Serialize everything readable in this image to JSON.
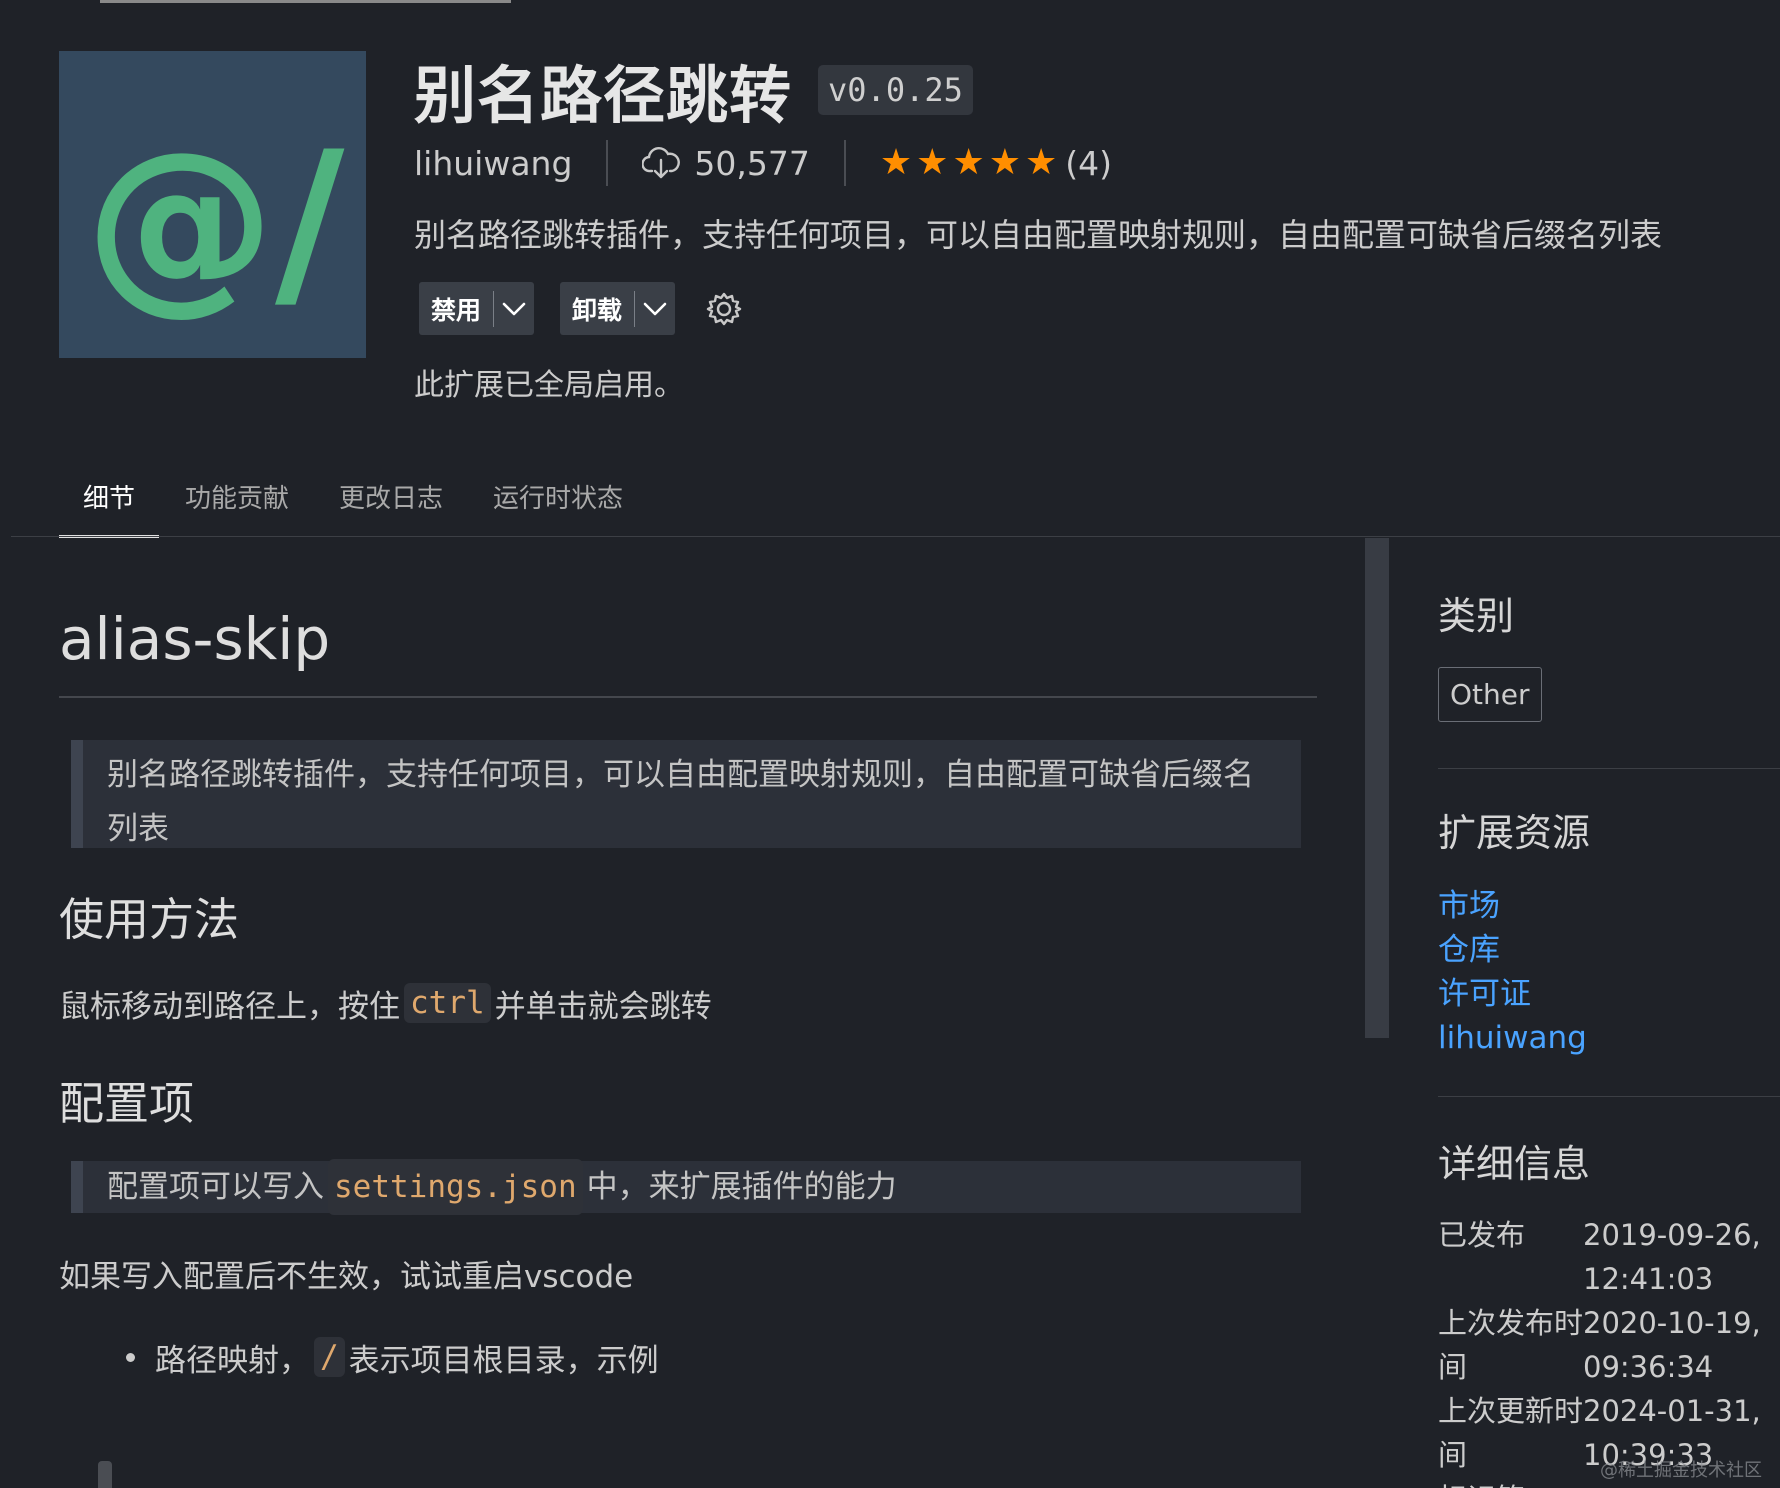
{
  "header": {
    "title": "别名路径跳转",
    "version": "v0.0.25",
    "publisher": "lihuiwang",
    "install_count": "50,577",
    "rating_count": "(4)",
    "rating_stars": 5,
    "description": "别名路径跳转插件，支持任何项目，可以自由配置映射规则，自由配置可缺省后缀名列表",
    "icon_text": "@/",
    "icon_colors": {
      "background": "#34495e",
      "glyph": "#4fb37f"
    },
    "disable_button": "禁用",
    "uninstall_button": "卸载",
    "enabled_status": "此扩展已全局启用。"
  },
  "tabs": [
    {
      "label": "细节",
      "active": true
    },
    {
      "label": "功能贡献",
      "active": false
    },
    {
      "label": "更改日志",
      "active": false
    },
    {
      "label": "运行时状态",
      "active": false
    }
  ],
  "readme": {
    "title": "alias-skip",
    "quote_intro": "别名路径跳转插件，支持任何项目，可以自由配置映射规则，自由配置可缺省后缀名列表",
    "usage_heading": "使用方法",
    "usage_before": "鼠标移动到路径上，按住",
    "usage_code": "ctrl",
    "usage_after": "并单击就会跳转",
    "config_heading": "配置项",
    "config_quote_before": "配置项可以写入",
    "config_quote_code": "settings.json",
    "config_quote_after": "中，来扩展插件的能力",
    "restart_note": "如果写入配置后不生效，试试重启vscode",
    "bullet_before": "路径映射，",
    "bullet_code": "/",
    "bullet_after": "表示项目根目录，示例"
  },
  "sidebar": {
    "category_heading": "类别",
    "category_tag": "Other",
    "resources_heading": "扩展资源",
    "resources": [
      "市场",
      "仓库",
      "许可证",
      "lihuiwang"
    ],
    "details_heading": "详细信息",
    "details": [
      {
        "key": "已发布",
        "value": "2019-09-26, 12:41:03"
      },
      {
        "key": "上次发布时间",
        "value": "2020-10-19, 09:36:34"
      },
      {
        "key": "上次更新时间",
        "value": "2024-01-31, 10:39:33"
      }
    ],
    "details_cut_key": "标识符"
  },
  "colors": {
    "background": "#1f2228",
    "link": "#4aa3ff",
    "star": "#ff8e00",
    "code_text": "#dfa86d"
  },
  "watermark": "@稀土掘金技术社区"
}
